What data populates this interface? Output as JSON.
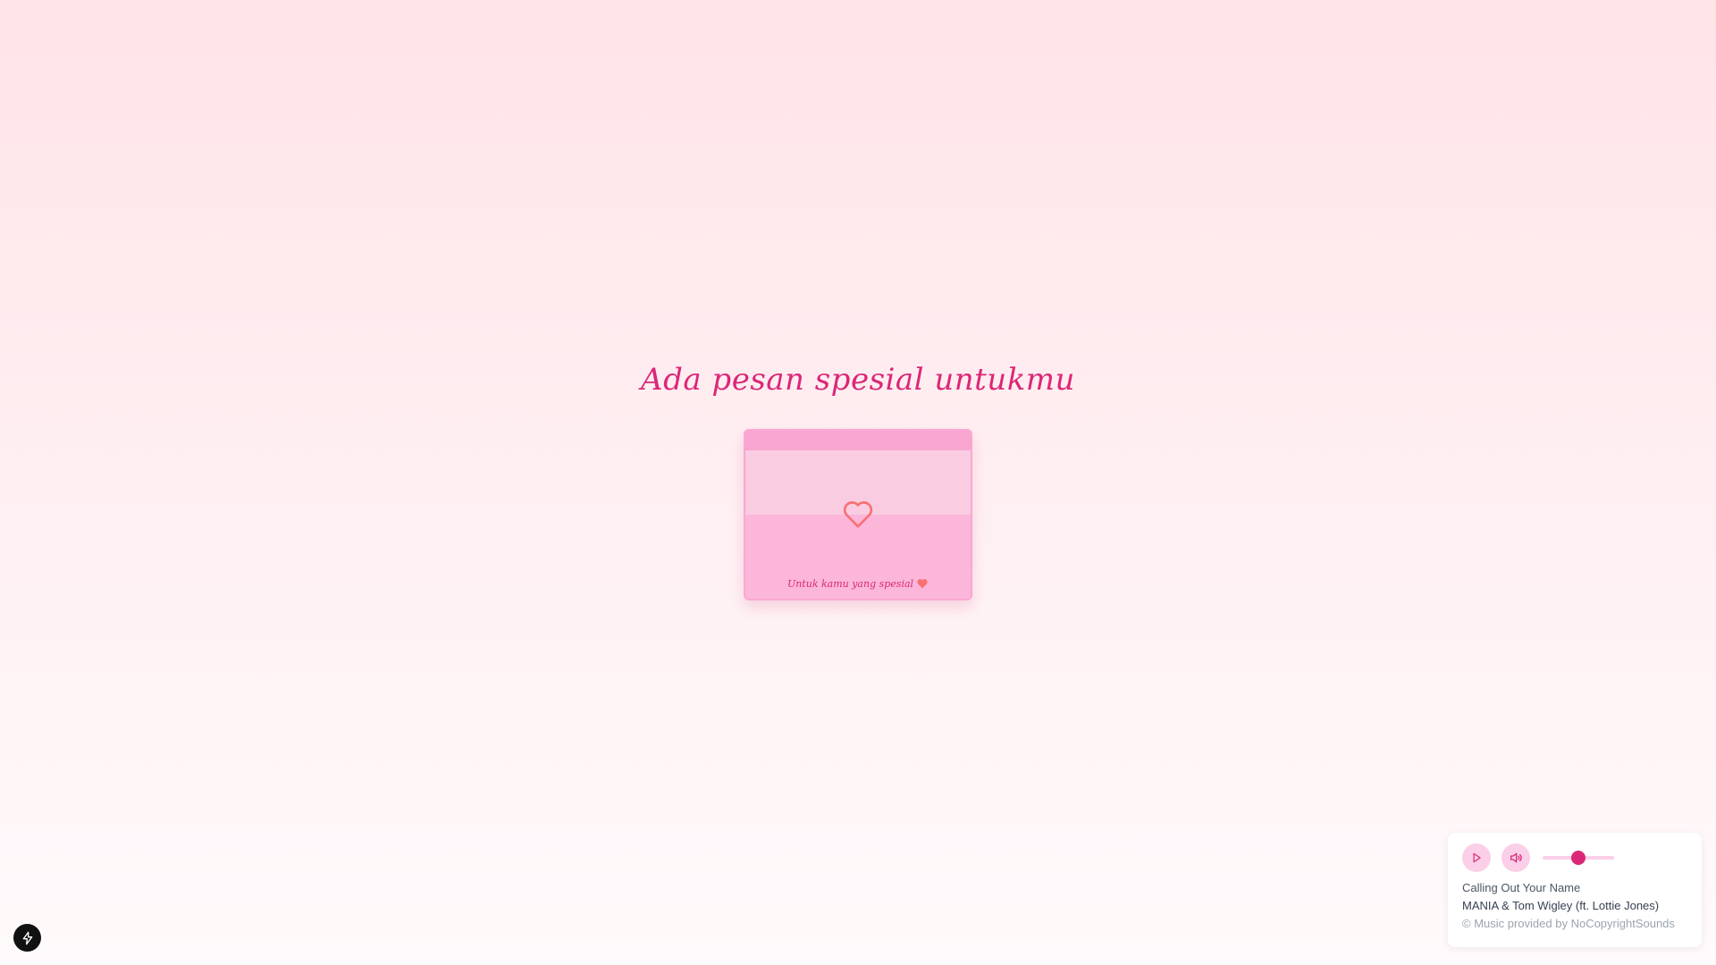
{
  "page": {
    "title": "Ada pesan spesial untukmu"
  },
  "envelope": {
    "caption": "Untuk kamu yang spesial",
    "icon": "heart-outline-icon",
    "colors": {
      "body": "#fbb6d9",
      "flap": "#f9cce2",
      "heart": "#f87171"
    }
  },
  "player": {
    "play_icon": "play-icon",
    "volume_icon": "volume-icon",
    "volume_level": 0.5,
    "track": {
      "title": "Calling Out Your Name",
      "artist": "MANIA & Tom Wigley (ft. Lottie Jones)",
      "credit": "© Music provided by NoCopyrightSounds"
    },
    "colors": {
      "accent": "#db2777",
      "accent_light": "#fbcfe8"
    }
  },
  "floating_button": {
    "icon": "lightning-bolt-icon"
  }
}
